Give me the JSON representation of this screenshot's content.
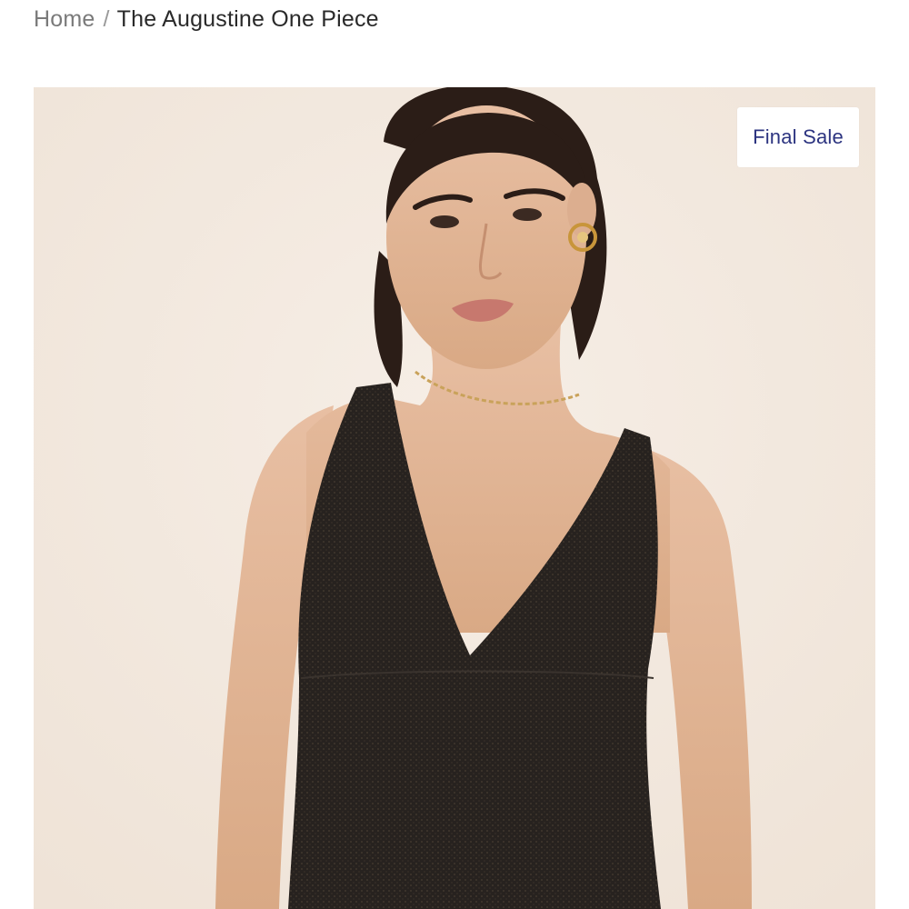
{
  "breadcrumb": {
    "home_label": "Home",
    "separator": "/",
    "current_label": "The Augustine One Piece"
  },
  "product": {
    "badge_label": "Final Sale",
    "image_semantic": "product-photo",
    "colors": {
      "background": "#f3e9df",
      "swimsuit": "#2a2522",
      "skin": "#e2b596",
      "hair": "#2b1d17",
      "badge_text": "#2c3480"
    }
  }
}
